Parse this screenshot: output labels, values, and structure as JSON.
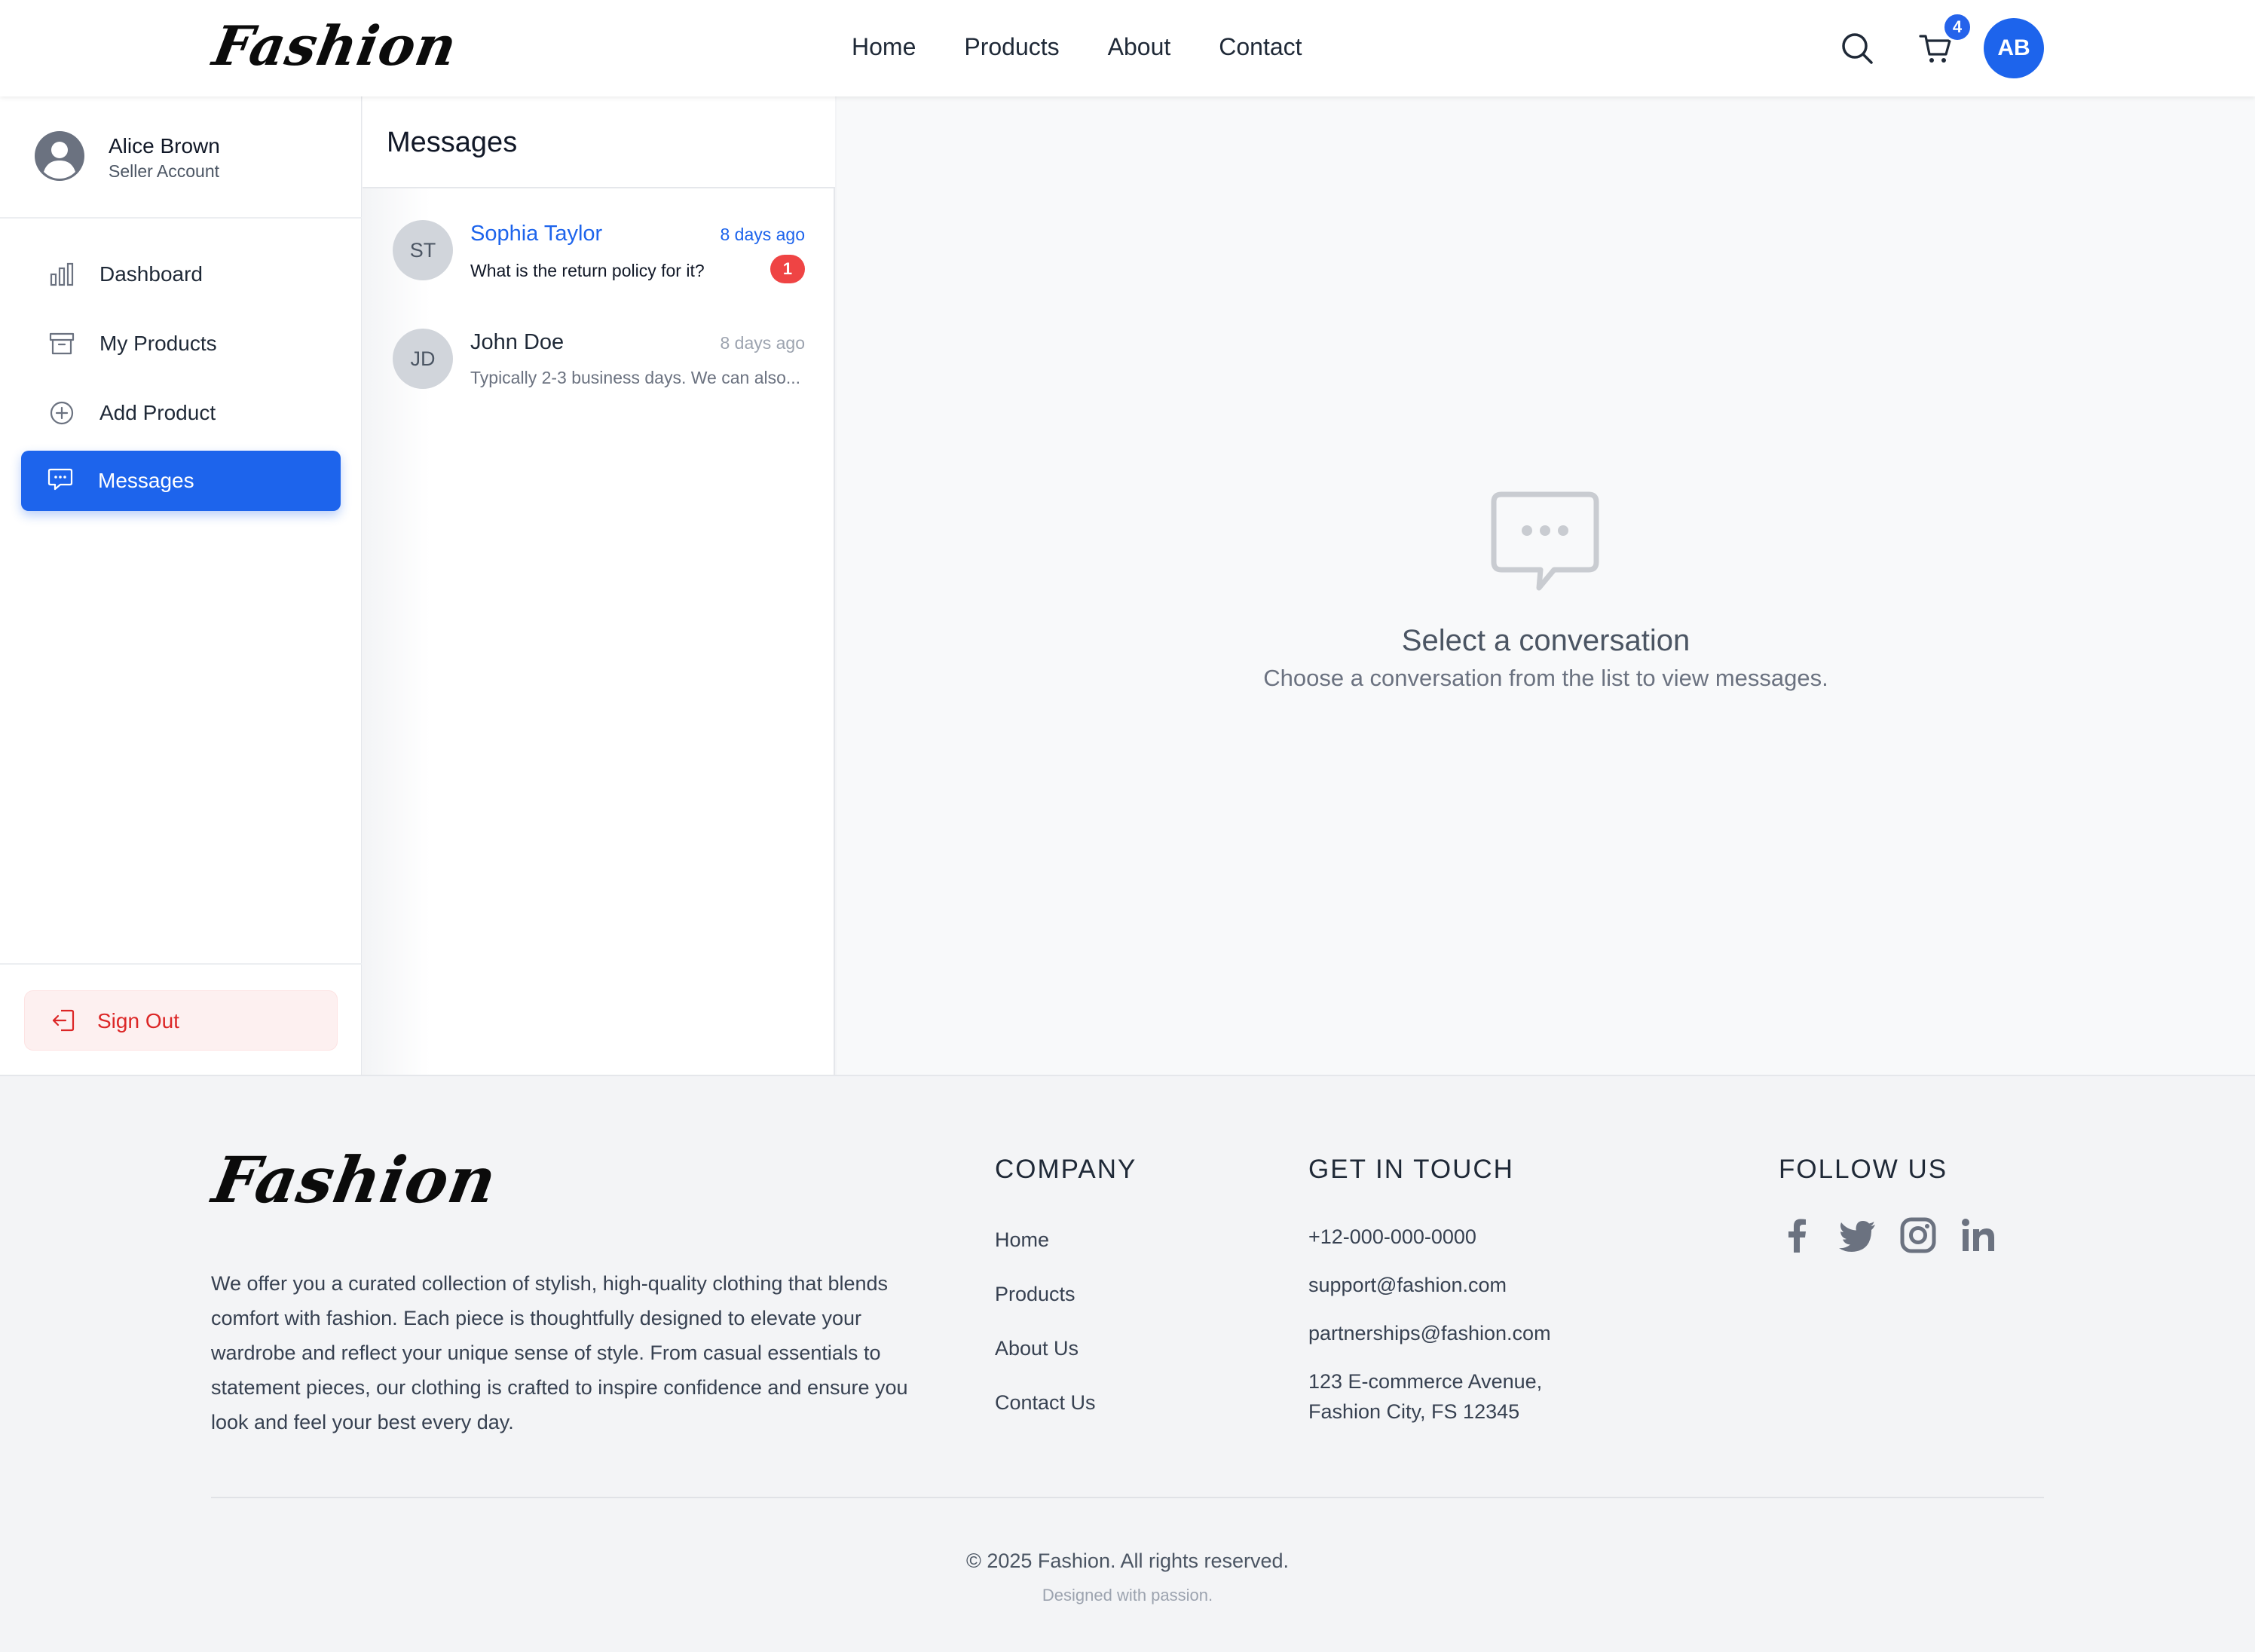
{
  "header": {
    "logo": "Fashion",
    "nav": [
      "Home",
      "Products",
      "About",
      "Contact"
    ],
    "cart_count": "4",
    "avatar_initials": "AB"
  },
  "sidebar": {
    "user_name": "Alice Brown",
    "user_role": "Seller Account",
    "items": [
      {
        "label": "Dashboard",
        "icon": "bar-chart-icon"
      },
      {
        "label": "My Products",
        "icon": "archive-box-icon"
      },
      {
        "label": "Add Product",
        "icon": "plus-circle-icon"
      },
      {
        "label": "Messages",
        "icon": "chat-bubble-icon",
        "active": true
      }
    ],
    "sign_out": "Sign Out"
  },
  "messages": {
    "title": "Messages",
    "conversations": [
      {
        "initials": "ST",
        "name": "Sophia Taylor",
        "time": "8 days ago",
        "snippet": "What is the return policy for it?",
        "unread": "1"
      },
      {
        "initials": "JD",
        "name": "John Doe",
        "time": "8 days ago",
        "snippet": "Typically 2-3 business days. We can also..."
      }
    ]
  },
  "empty_state": {
    "title": "Select a conversation",
    "subtitle": "Choose a conversation from the list to view messages."
  },
  "footer": {
    "logo": "Fashion",
    "about": "We offer you a curated collection of stylish, high-quality clothing that blends comfort with fashion. Each piece is thoughtfully designed to elevate your wardrobe and reflect your unique sense of style. From casual essentials to statement pieces, our clothing is crafted to inspire confidence and ensure you look and feel your best every day.",
    "company_heading": "COMPANY",
    "company_links": [
      "Home",
      "Products",
      "About Us",
      "Contact Us"
    ],
    "contact_heading": "GET IN TOUCH",
    "phone": "+12-000-000-0000",
    "support_email": "support@fashion.com",
    "partner_email": "partnerships@fashion.com",
    "address_line1": "123 E-commerce Avenue,",
    "address_line2": "Fashion City, FS 12345",
    "follow_heading": "FOLLOW US",
    "social": [
      "facebook-icon",
      "twitter-icon",
      "instagram-icon",
      "linkedin-icon"
    ],
    "copyright": "© 2025 Fashion. All rights reserved.",
    "designed": "Designed with passion."
  },
  "colors": {
    "accent": "#1d64ec",
    "danger": "#ef4444",
    "signout_text": "#dc2626",
    "page_bg": "#f3f4f6"
  }
}
